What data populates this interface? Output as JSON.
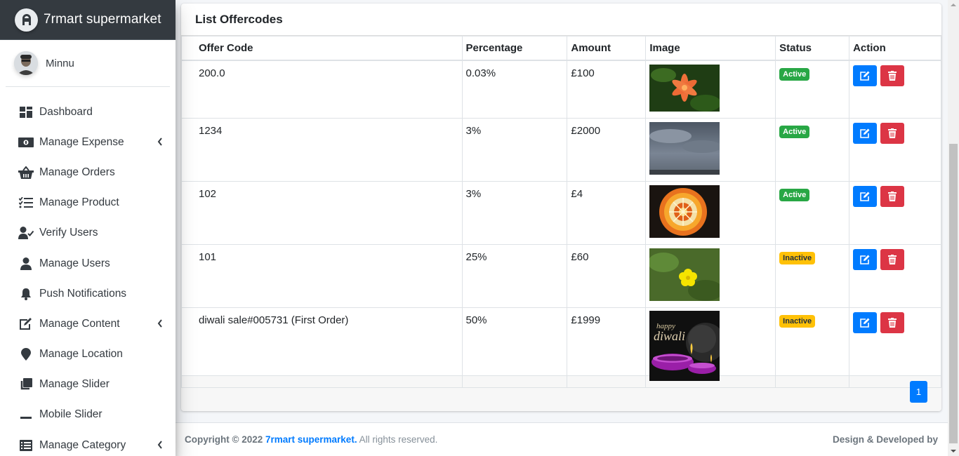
{
  "brand": {
    "name": "7rmart supermarket",
    "icon": "brand-logo-icon"
  },
  "user": {
    "name": "Minnu"
  },
  "sidebar": {
    "items": [
      {
        "label": "Dashboard",
        "icon": "dashboard-icon",
        "has_arrow": false
      },
      {
        "label": "Manage Expense",
        "icon": "money-icon",
        "has_arrow": true
      },
      {
        "label": "Manage Orders",
        "icon": "basket-icon",
        "has_arrow": false
      },
      {
        "label": "Manage Product",
        "icon": "tasks-icon",
        "has_arrow": false
      },
      {
        "label": "Verify Users",
        "icon": "user-check-icon",
        "has_arrow": false
      },
      {
        "label": "Manage Users",
        "icon": "user-icon",
        "has_arrow": false
      },
      {
        "label": "Push Notifications",
        "icon": "bell-icon",
        "has_arrow": false
      },
      {
        "label": "Manage Content",
        "icon": "edit-icon",
        "has_arrow": true
      },
      {
        "label": "Manage Location",
        "icon": "map-marker-icon",
        "has_arrow": false
      },
      {
        "label": "Manage Slider",
        "icon": "clone-icon",
        "has_arrow": false
      },
      {
        "label": "Mobile Slider",
        "icon": "minus-icon",
        "has_arrow": false
      },
      {
        "label": "Manage Category",
        "icon": "list-icon",
        "has_arrow": true
      }
    ]
  },
  "card": {
    "title": "List Offercodes"
  },
  "table": {
    "headers": [
      "Offer Code",
      "Percentage",
      "Amount",
      "Image",
      "Status",
      "Action"
    ],
    "rows": [
      {
        "code": "200.0",
        "percentage": "0.03%",
        "amount": "£100",
        "image": "flower-lily-image",
        "status": "Active"
      },
      {
        "code": "1234",
        "percentage": "3%",
        "amount": "£2000",
        "image": "cloudy-sky-image",
        "status": "Active"
      },
      {
        "code": "102",
        "percentage": "3%",
        "amount": "£4",
        "image": "flower-rangoli-image",
        "status": "Active"
      },
      {
        "code": "101",
        "percentage": "25%",
        "amount": "£60",
        "image": "yellow-flower-image",
        "status": "Inactive"
      },
      {
        "code": "diwali sale#005731 (First Order)",
        "percentage": "50%",
        "amount": "£1999",
        "image": "diwali-lamps-image",
        "status": "Inactive"
      }
    ]
  },
  "pagination": {
    "current": "1"
  },
  "footer": {
    "copyright_prefix": "Copyright © 2022",
    "company": "7rmart supermarket.",
    "rights": "All rights reserved.",
    "right_text": "Design & Developed by"
  },
  "colors": {
    "primary": "#007bff",
    "danger": "#dc3545",
    "success": "#28a745",
    "warning": "#ffc107",
    "brand_bg": "#343a40"
  }
}
